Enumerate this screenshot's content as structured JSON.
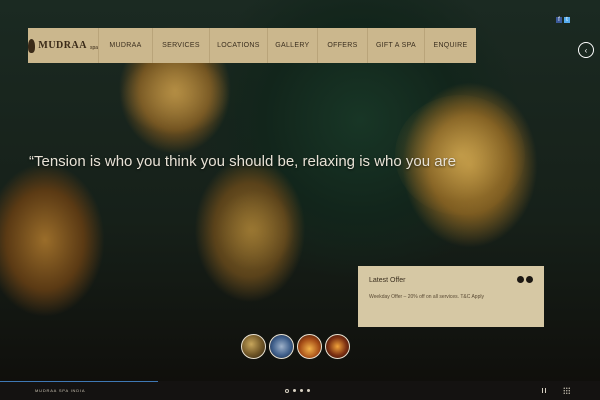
{
  "brand": {
    "logo_text": "MUDRAA",
    "logo_sub": "spa"
  },
  "social": {
    "facebook_glyph": "f",
    "twitter_glyph": "t"
  },
  "nav": {
    "items": [
      "MUDRAA",
      "SERVICES",
      "LOCATIONS",
      "GALLERY",
      "OFFERS",
      "GIFT A SPA",
      "ENQUIRE"
    ]
  },
  "hero": {
    "quote": "“Tension is who you think you should be, relaxing is who you are",
    "circle_glyph": "‹"
  },
  "offer": {
    "title": "Latest Offer",
    "text": "Weekday Offer – 20% off on all services. T&C Apply"
  },
  "footer": {
    "brand": "MUDRAA SPA INDIA"
  },
  "colors": {
    "nav_bg": "#cbb78d",
    "offer_bg": "#d6c8a4",
    "progress": "#3f78b4"
  },
  "icons": [
    "facebook-icon",
    "twitter-icon",
    "circle-button-icon",
    "pause-icon",
    "grid-icon"
  ]
}
